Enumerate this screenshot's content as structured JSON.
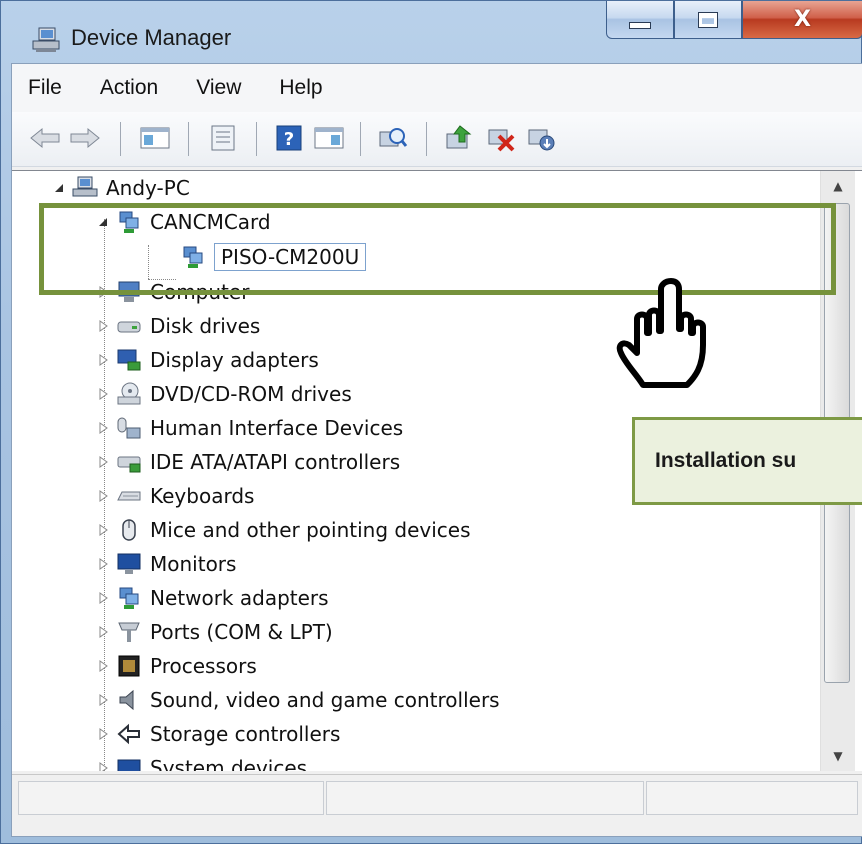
{
  "window": {
    "title": "Device Manager",
    "close_glyph": "X"
  },
  "menu": [
    {
      "label": "File"
    },
    {
      "label": "Action"
    },
    {
      "label": "View"
    },
    {
      "label": "Help"
    }
  ],
  "toolbar": {
    "icons": [
      "back-arrow-icon",
      "forward-arrow-icon",
      "show-hide-console-tree-icon",
      "properties-icon",
      "help-icon",
      "action-pane-icon",
      "scan-hardware-icon",
      "update-driver-icon",
      "uninstall-icon",
      "disable-device-icon"
    ]
  },
  "tree": {
    "root": {
      "label": "Andy-PC"
    },
    "highlighted_group": {
      "label": "CANCMCard",
      "child": "PISO-CM200U"
    },
    "categories": [
      {
        "label": "Computer",
        "icon": "computer-icon"
      },
      {
        "label": "Disk drives",
        "icon": "disk-drive-icon"
      },
      {
        "label": "Display adapters",
        "icon": "display-adapter-icon"
      },
      {
        "label": "DVD/CD-ROM drives",
        "icon": "dvd-drive-icon"
      },
      {
        "label": "Human Interface Devices",
        "icon": "hid-icon"
      },
      {
        "label": "IDE ATA/ATAPI controllers",
        "icon": "ide-controller-icon"
      },
      {
        "label": "Keyboards",
        "icon": "keyboard-icon"
      },
      {
        "label": "Mice and other pointing devices",
        "icon": "mouse-icon"
      },
      {
        "label": "Monitors",
        "icon": "monitor-icon"
      },
      {
        "label": "Network adapters",
        "icon": "network-adapter-icon"
      },
      {
        "label": "Ports (COM & LPT)",
        "icon": "port-icon"
      },
      {
        "label": "Processors",
        "icon": "processor-icon"
      },
      {
        "label": "Sound, video and game controllers",
        "icon": "speaker-icon"
      },
      {
        "label": "Storage controllers",
        "icon": "storage-controller-icon"
      },
      {
        "label": "System devices",
        "icon": "system-devices-icon"
      }
    ]
  },
  "callout": {
    "text": "Installation su"
  },
  "colors": {
    "highlight_border": "#76923c",
    "callout_bg": "#ebf1de",
    "close_button": "#c0472c"
  }
}
